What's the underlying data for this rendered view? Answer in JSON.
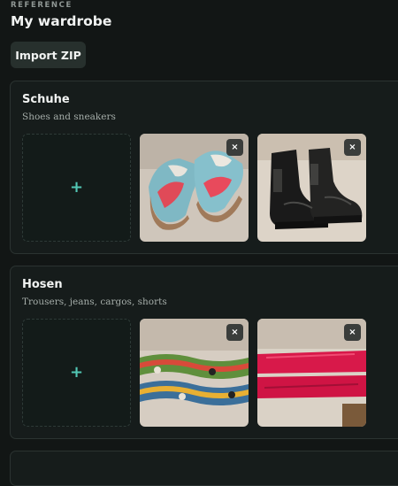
{
  "header": {
    "eyebrow": "REFERENCE",
    "title": "My wardrobe",
    "import_label": "Import ZIP"
  },
  "sections": [
    {
      "title": "Schuhe",
      "description": "Shoes and sneakers",
      "add_symbol": "+",
      "items": [
        {
          "remove_symbol": "×",
          "subject": "light blue sneakers with red stripe"
        },
        {
          "remove_symbol": "×",
          "subject": "black leather chelsea boots"
        }
      ]
    },
    {
      "title": "Hosen",
      "description": "Trousers, jeans, cargos, shorts",
      "add_symbol": "+",
      "items": [
        {
          "remove_symbol": "×",
          "subject": "colorful patterned trousers"
        },
        {
          "remove_symbol": "×",
          "subject": "pink trousers"
        }
      ]
    }
  ],
  "colors": {
    "background": "#121615",
    "card": "#161c1b",
    "accent_plus": "#52c7b4",
    "button": "#27302d"
  },
  "icons": {
    "add": "plus-icon",
    "remove": "close-icon"
  }
}
